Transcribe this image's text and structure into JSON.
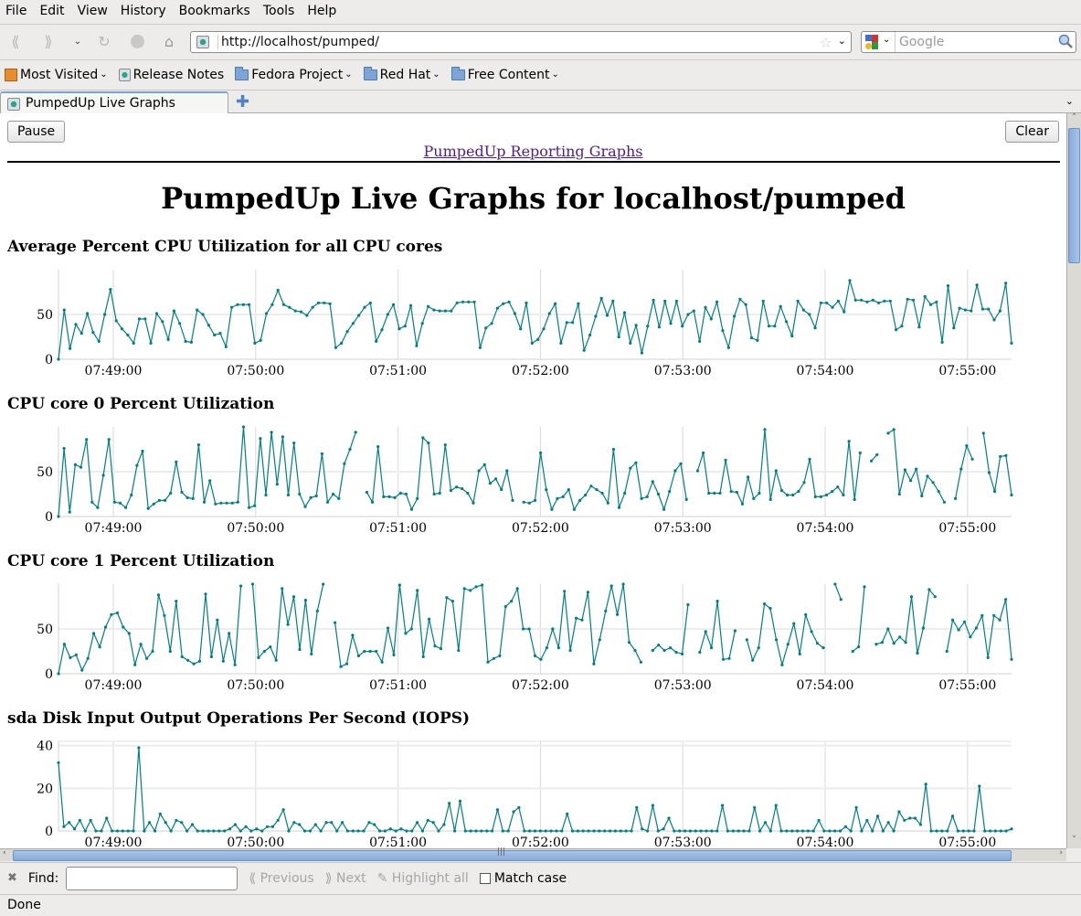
{
  "browser": {
    "menu": [
      "File",
      "Edit",
      "View",
      "History",
      "Bookmarks",
      "Tools",
      "Help"
    ],
    "menu_underline": [
      "F",
      "E",
      "V",
      "s",
      "B",
      "T",
      "H"
    ],
    "url": "http://localhost/pumped/",
    "search_placeholder": "Google",
    "bookmarks": [
      {
        "label": "Most Visited",
        "icon": "most-visited-icon",
        "dropdown": true
      },
      {
        "label": "Release Notes",
        "icon": "page-icon",
        "dropdown": false
      },
      {
        "label": "Fedora Project",
        "icon": "folder-icon",
        "dropdown": true
      },
      {
        "label": "Red Hat",
        "icon": "folder-icon",
        "dropdown": true
      },
      {
        "label": "Free Content",
        "icon": "folder-icon",
        "dropdown": true
      }
    ],
    "tab_title": "PumpedUp Live Graphs",
    "status": "Done"
  },
  "findbar": {
    "label": "Find:",
    "value": "",
    "previous": "Previous",
    "next": "Next",
    "highlight_all": "Highlight all",
    "match_case": "Match case",
    "match_case_checked": false
  },
  "page": {
    "pause_label": "Pause",
    "clear_label": "Clear",
    "reporting_link": "PumpedUp Reporting Graphs",
    "heading": "PumpedUp Live Graphs for localhost/pumped",
    "line_color": "#008080"
  },
  "chart_data": [
    {
      "type": "line",
      "title": "Average Percent CPU Utilization for all CPU cores",
      "x_unit": "seconds since 07:48:37",
      "x_ticks": [
        "07:49:00",
        "07:50:00",
        "07:51:00",
        "07:52:00",
        "07:53:00",
        "07:54:00",
        "07:55:00"
      ],
      "x_range": [
        "07:48:37",
        "07:55:18"
      ],
      "y_ticks": [
        0,
        50
      ],
      "ylim": [
        0,
        100
      ],
      "grid": true,
      "values": [
        0,
        55,
        12,
        39,
        29,
        51,
        30,
        20,
        50,
        78,
        43,
        34,
        27,
        18,
        45,
        45,
        18,
        51,
        42,
        22,
        54,
        40,
        20,
        19,
        55,
        50,
        38,
        27,
        29,
        14,
        58,
        61,
        61,
        61,
        18,
        21,
        51,
        61,
        77,
        61,
        58,
        54,
        53,
        49,
        58,
        63,
        63,
        62,
        13,
        18,
        31,
        40,
        49,
        58,
        63,
        20,
        33,
        50,
        61,
        34,
        37,
        60,
        15,
        40,
        59,
        55,
        54,
        54,
        54,
        63,
        64,
        64,
        64,
        13,
        35,
        40,
        57,
        62,
        64,
        51,
        34,
        63,
        18,
        22,
        34,
        51,
        62,
        18,
        41,
        41,
        62,
        10,
        27,
        48,
        68,
        49,
        65,
        25,
        52,
        18,
        38,
        7,
        37,
        66,
        36,
        65,
        40,
        65,
        37,
        50,
        54,
        20,
        58,
        45,
        64,
        32,
        13,
        48,
        67,
        61,
        24,
        21,
        65,
        37,
        37,
        59,
        42,
        26,
        65,
        55,
        50,
        35,
        63,
        63,
        58,
        65,
        53,
        88,
        66,
        66,
        64,
        66,
        63,
        65,
        65,
        33,
        37,
        67,
        66,
        36,
        70,
        61,
        64,
        19,
        82,
        35,
        57,
        55,
        54,
        83,
        56,
        56,
        44,
        54,
        85,
        18
      ]
    },
    {
      "type": "line",
      "title": "CPU core 0 Percent Utilization",
      "x_ticks": [
        "07:49:00",
        "07:50:00",
        "07:51:00",
        "07:52:00",
        "07:53:00",
        "07:54:00",
        "07:55:00"
      ],
      "y_ticks": [
        0,
        50
      ],
      "ylim": [
        0,
        100
      ],
      "grid": true,
      "values": [
        0,
        76,
        5,
        58,
        55,
        86,
        16,
        10,
        46,
        86,
        16,
        15,
        10,
        24,
        57,
        73,
        9,
        14,
        18,
        18,
        26,
        61,
        27,
        21,
        20,
        80,
        16,
        40,
        14,
        15,
        15,
        15,
        16,
        100,
        10,
        12,
        87,
        24,
        94,
        36,
        89,
        24,
        82,
        25,
        11,
        21,
        23,
        70,
        16,
        25,
        20,
        59,
        75,
        94,
        null,
        27,
        16,
        78,
        22,
        22,
        21,
        26,
        25,
        8,
        20,
        88,
        82,
        25,
        26,
        80,
        29,
        33,
        31,
        26,
        15,
        51,
        58,
        37,
        42,
        30,
        51,
        18,
        null,
        16,
        15,
        18,
        71,
        30,
        8,
        20,
        22,
        30,
        8,
        18,
        24,
        34,
        30,
        26,
        15,
        75,
        10,
        26,
        54,
        60,
        20,
        22,
        39,
        25,
        8,
        28,
        51,
        59,
        19,
        null,
        51,
        71,
        26,
        26,
        26,
        63,
        28,
        27,
        14,
        44,
        20,
        26,
        97,
        19,
        51,
        29,
        24,
        24,
        28,
        38,
        64,
        22,
        22,
        24,
        28,
        33,
        24,
        84,
        19,
        71,
        null,
        62,
        69,
        null,
        93,
        97,
        25,
        52,
        40,
        53,
        23,
        45,
        38,
        28,
        16,
        null,
        20,
        53,
        79,
        64,
        null,
        93,
        49,
        28,
        67,
        68,
        24
      ]
    },
    {
      "type": "line",
      "title": "CPU core 1 Percent Utilization",
      "x_ticks": [
        "07:49:00",
        "07:50:00",
        "07:51:00",
        "07:52:00",
        "07:53:00",
        "07:54:00",
        "07:55:00"
      ],
      "y_ticks": [
        0,
        50
      ],
      "ylim": [
        0,
        100
      ],
      "grid": true,
      "values": [
        0,
        33,
        18,
        21,
        4,
        17,
        45,
        30,
        52,
        66,
        68,
        52,
        45,
        10,
        33,
        17,
        25,
        88,
        65,
        25,
        81,
        19,
        15,
        11,
        14,
        89,
        19,
        60,
        14,
        45,
        10,
        98,
        null,
        100,
        18,
        25,
        30,
        15,
        95,
        55,
        86,
        27,
        82,
        22,
        70,
        100,
        null,
        57,
        8,
        11,
        43,
        20,
        25,
        25,
        25,
        13,
        51,
        21,
        99,
        45,
        50,
        93,
        19,
        61,
        31,
        28,
        85,
        81,
        26,
        95,
        93,
        97,
        99,
        13,
        17,
        20,
        75,
        81,
        95,
        50,
        50,
        20,
        16,
        29,
        50,
        29,
        92,
        26,
        62,
        60,
        91,
        11,
        38,
        70,
        98,
        66,
        100,
        35,
        26,
        13,
        null,
        26,
        32,
        26,
        29,
        24,
        22,
        77,
        null,
        24,
        47,
        29,
        81,
        16,
        17,
        48,
        null,
        38,
        15,
        29,
        78,
        73,
        38,
        10,
        33,
        56,
        22,
        66,
        47,
        34,
        29,
        null,
        100,
        83,
        null,
        25,
        30,
        97,
        null,
        33,
        35,
        50,
        34,
        41,
        35,
        86,
        23,
        51,
        94,
        86,
        null,
        25,
        60,
        49,
        58,
        41,
        51,
        65,
        18,
        65,
        60,
        83,
        16
      ]
    },
    {
      "type": "line",
      "title": "sda Disk Input Output Operations Per Second (IOPS)",
      "x_ticks": [
        "07:49:00",
        "07:50:00",
        "07:51:00",
        "07:52:00",
        "07:53:00",
        "07:54:00",
        "07:55:00"
      ],
      "y_ticks": [
        0,
        20,
        40
      ],
      "ylim": [
        0,
        42
      ],
      "grid": true,
      "values": [
        32,
        2,
        4,
        1,
        5,
        0,
        5,
        0,
        0,
        6,
        0,
        0,
        0,
        0,
        0,
        39,
        0,
        4,
        0,
        8,
        4,
        0,
        5,
        4,
        0,
        3,
        0,
        0,
        0,
        0,
        0,
        0,
        1,
        3,
        0,
        2,
        0,
        1,
        0,
        2,
        2,
        5,
        10,
        0,
        4,
        3,
        0,
        0,
        3,
        0,
        4,
        4,
        0,
        4,
        0,
        0,
        0,
        0,
        4,
        3,
        0,
        0,
        1,
        0,
        1,
        0,
        0,
        4,
        0,
        5,
        4,
        0,
        3,
        13,
        0,
        14,
        0,
        0,
        0,
        0,
        0,
        0,
        10,
        0,
        0,
        9,
        11,
        0,
        0,
        0,
        0,
        0,
        0,
        0,
        0,
        8,
        0,
        0,
        0,
        0,
        0,
        0,
        0,
        0,
        0,
        0,
        0,
        0,
        11,
        1,
        0,
        12,
        0,
        1,
        6,
        0,
        0,
        0,
        0,
        0,
        0,
        0,
        0,
        0,
        12,
        0,
        0,
        0,
        0,
        0,
        11,
        0,
        4,
        0,
        12,
        0,
        0,
        0,
        0,
        0,
        0,
        0,
        5,
        0,
        0,
        0,
        0,
        2,
        0,
        11,
        0,
        5,
        0,
        7,
        0,
        4,
        0,
        9,
        5,
        6,
        6,
        3,
        22,
        0,
        0,
        0,
        0,
        7,
        0,
        0,
        0,
        0,
        21,
        0,
        0,
        0,
        0,
        0,
        1
      ]
    }
  ]
}
